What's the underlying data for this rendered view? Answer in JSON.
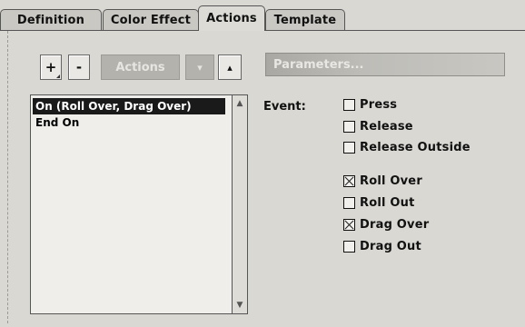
{
  "tabs": [
    {
      "label": "Definition",
      "active": false
    },
    {
      "label": "Color Effect",
      "active": false
    },
    {
      "label": "Actions",
      "active": true
    },
    {
      "label": "Template",
      "active": false
    }
  ],
  "toolbar": {
    "add_label": "+",
    "remove_label": "-",
    "actions_popup_label": "Actions",
    "move_down_icon": "▾",
    "move_up_icon": "▴",
    "path_field_value": "Parameters..."
  },
  "action_list": {
    "items": [
      {
        "label": "On (Roll Over, Drag Over)",
        "selected": true
      },
      {
        "label": "End On",
        "selected": false
      }
    ]
  },
  "event": {
    "label": "Event:",
    "options": [
      {
        "label": "Press",
        "checked": false
      },
      {
        "label": "Release",
        "checked": false
      },
      {
        "label": "Release Outside",
        "checked": false
      },
      {
        "label": "Roll Over",
        "checked": true
      },
      {
        "label": "Roll Out",
        "checked": false
      },
      {
        "label": "Drag Over",
        "checked": true
      },
      {
        "label": "Drag Out",
        "checked": false
      }
    ]
  }
}
